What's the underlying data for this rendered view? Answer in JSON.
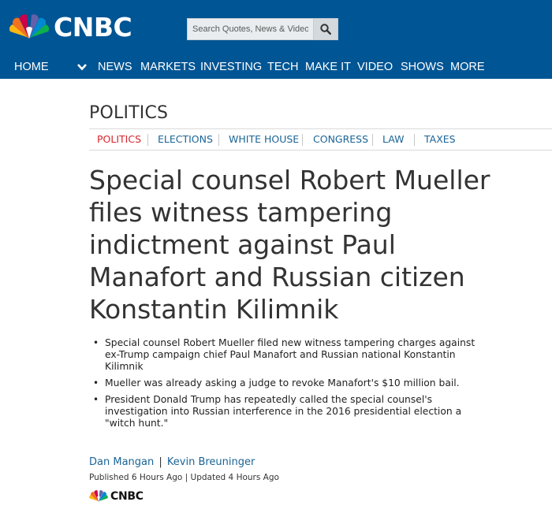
{
  "header": {
    "brand": "CNBC",
    "search": {
      "placeholder": "Search Quotes, News & Video"
    },
    "nav": [
      "HOME",
      "NEWS",
      "MARKETS",
      "INVESTING",
      "TECH",
      "MAKE IT",
      "VIDEO",
      "SHOWS",
      "MORE"
    ]
  },
  "section": {
    "title": "POLITICS",
    "subnav": [
      "POLITICS",
      "ELECTIONS",
      "WHITE HOUSE",
      "CONGRESS",
      "LAW",
      "TAXES"
    ],
    "active": "POLITICS"
  },
  "article": {
    "headline_lines": [
      "Special counsel Robert Mueller",
      "files witness tampering",
      "indictment against Paul",
      "Manafort and Russian citizen",
      "Konstantin Kilimnik"
    ],
    "bullets": [
      "Special counsel Robert Mueller filed new witness tampering charges against ex-Trump campaign chief Paul Manafort and Russian national Konstantin Kilimnik",
      "Mueller was already asking a judge to revoke Manafort's $10 million bail.",
      "President Donald Trump has repeatedly called the special counsel's investigation into Russian interference in the 2016 presidential election a \"witch hunt.\""
    ],
    "bullet_lines": [
      [
        "Special counsel Robert Mueller filed new witness tampering charges against",
        "ex-Trump campaign chief Paul Manafort and Russian national Konstantin",
        "Kilimnik"
      ],
      [
        "Mueller was already asking a judge to revoke Manafort's $10 million bail."
      ],
      [
        "President Donald Trump has repeatedly called the special counsel's",
        "investigation into Russian interference in the 2016 presidential election a",
        "\"witch hunt.\""
      ]
    ],
    "authors": [
      "Dan Mangan",
      "Kevin Breuninger"
    ],
    "author_separator": "|",
    "published": "Published 6 Hours Ago",
    "updated": "Updated 4 Hours Ago",
    "date_separator": "|",
    "source_logo": "CNBC"
  },
  "colors": {
    "header_bg": "#005594",
    "link": "#1a6496",
    "active_tab": "#d8232a"
  },
  "icons": {
    "logo": "nbc-peacock-icon",
    "search": "search-icon",
    "nav_toggle": "chevron-down-icon"
  }
}
